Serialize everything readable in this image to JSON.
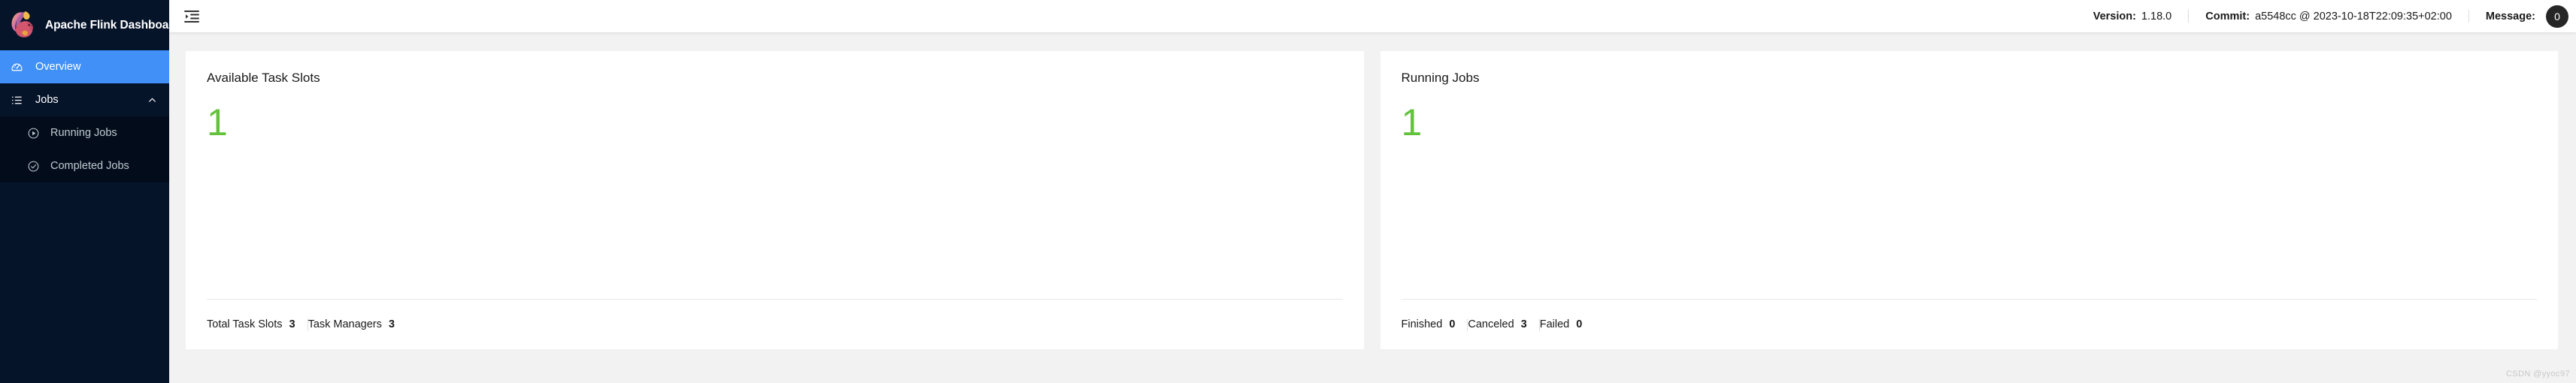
{
  "brand": {
    "title": "Apache Flink Dashboard",
    "logo_icon": "flink-squirrel-logo"
  },
  "sidebar": {
    "items": [
      {
        "label": "Overview",
        "icon": "dashboard-gauge-icon",
        "active": true
      },
      {
        "label": "Jobs",
        "icon": "unordered-list-icon",
        "active": false,
        "expanded": true,
        "caret_icon": "chevron-up-icon"
      }
    ],
    "subitems": [
      {
        "label": "Running Jobs",
        "icon": "play-circle-icon"
      },
      {
        "label": "Completed Jobs",
        "icon": "check-circle-icon"
      }
    ]
  },
  "topbar": {
    "fold_icon": "menu-fold-icon",
    "version_label": "Version:",
    "version_value": "1.18.0",
    "commit_label": "Commit:",
    "commit_value": "a5548cc @ 2023-10-18T22:09:35+02:00",
    "message_label": "Message:",
    "message_count": "0"
  },
  "cards": [
    {
      "title": "Available Task Slots",
      "value": "1",
      "value_color": "#63c23c",
      "stats": [
        {
          "label": "Total Task Slots",
          "value": "3"
        },
        {
          "label": "Task Managers",
          "value": "3"
        }
      ]
    },
    {
      "title": "Running Jobs",
      "value": "1",
      "value_color": "#63c23c",
      "stats": [
        {
          "label": "Finished",
          "value": "0"
        },
        {
          "label": "Canceled",
          "value": "3"
        },
        {
          "label": "Failed",
          "value": "0"
        }
      ]
    }
  ],
  "watermark": "CSDN @yyoc97",
  "colors": {
    "sidebar_bg": "#06142a",
    "subnav_bg": "#020c1b",
    "active_blue": "#4190f7",
    "content_bg": "#f2f2f2",
    "accent_green": "#63c23c",
    "badge_dark": "#262626"
  }
}
